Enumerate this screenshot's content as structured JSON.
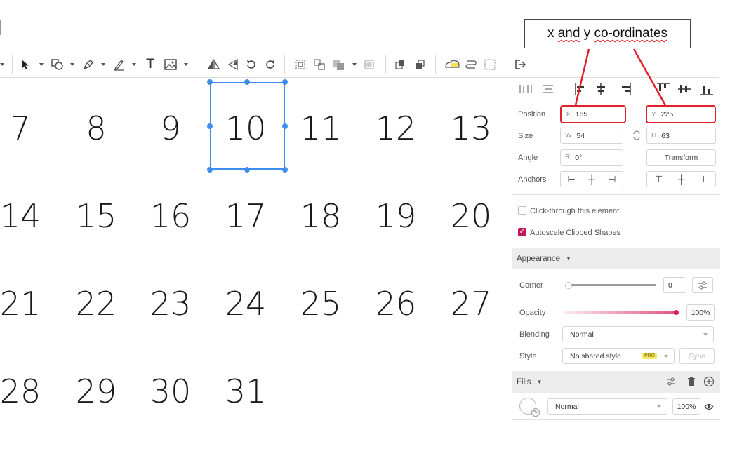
{
  "callout": {
    "prefix": "x ",
    "and": "and",
    "mid": " y ",
    "coords": "co-ordinates"
  },
  "calendar": {
    "rows": [
      [
        "7",
        "8",
        "9",
        "10",
        "11",
        "12",
        "13"
      ],
      [
        "14",
        "15",
        "16",
        "17",
        "18",
        "19",
        "20"
      ],
      [
        "21",
        "22",
        "23",
        "24",
        "25",
        "26",
        "27"
      ],
      [
        "28",
        "29",
        "30",
        "31"
      ]
    ],
    "selected": "10"
  },
  "panel": {
    "position_label": "Position",
    "x_prefix": "X",
    "x_value": "165",
    "y_prefix": "Y",
    "y_value": "225",
    "size_label": "Size",
    "w_prefix": "W",
    "w_value": "54",
    "h_prefix": "H",
    "h_value": "63",
    "angle_label": "Angle",
    "r_prefix": "R",
    "r_value": "0°",
    "transform_label": "Transform",
    "anchors_label": "Anchors",
    "click_through_label": "Click-through this element",
    "click_through_checked": false,
    "autoscale_label": "Autoscale Clipped Shapes",
    "autoscale_checked": true,
    "appearance_label": "Appearance",
    "corner_label": "Corner",
    "corner_value": "0",
    "opacity_label": "Opacity",
    "opacity_value": "100%",
    "opacity_level": 1.0,
    "blending_label": "Blending",
    "blending_value": "Normal",
    "style_label": "Style",
    "style_value": "No shared style",
    "pro_badge": "PRO",
    "sync_label": "Sync",
    "fills_label": "Fills",
    "fill_blend_value": "Normal",
    "fill_opacity_value": "100%"
  },
  "colors": {
    "accent": "#3d8ef0",
    "highlight": "#e0202a",
    "checkbox": "#c2185b"
  }
}
